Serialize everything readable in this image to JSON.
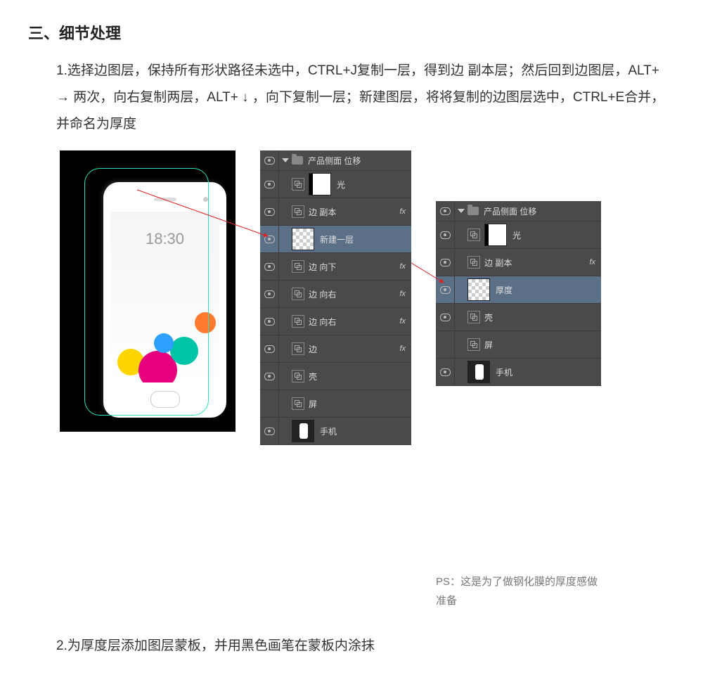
{
  "section_title": "三、细节处理",
  "step1_text": "1.选择边图层，保持所有形状路径未选中，CTRL+J复制一层，得到边 副本层；然后回到边图层，ALT+ → 两次，向右复制两层，ALT+ ↓ ，向下复制一层；新建图层，将将复制的边图层选中，CTRL+E合并，并命名为厚度",
  "phone_time": "18:30",
  "panel1": {
    "group_name": "产品侧面 位移",
    "layers": [
      {
        "label": "光",
        "thumb": "mask",
        "fx": false,
        "vis": true
      },
      {
        "label": "边 副本",
        "thumb": "link",
        "fx": true,
        "vis": true
      },
      {
        "label": "新建一层",
        "thumb": "checker",
        "fx": false,
        "vis": true,
        "active": true
      },
      {
        "label": "边 向下",
        "thumb": "link",
        "fx": true,
        "vis": true
      },
      {
        "label": "边 向右",
        "thumb": "link",
        "fx": true,
        "vis": true
      },
      {
        "label": "边 向右",
        "thumb": "link",
        "fx": true,
        "vis": true
      },
      {
        "label": "边",
        "thumb": "link",
        "fx": true,
        "vis": true
      },
      {
        "label": "壳",
        "thumb": "link",
        "fx": false,
        "vis": true
      },
      {
        "label": "屏",
        "thumb": "link",
        "fx": false,
        "vis": false
      },
      {
        "label": "手机",
        "thumb": "phone",
        "fx": false,
        "vis": true
      }
    ]
  },
  "panel2": {
    "group_name": "产品侧面 位移",
    "layers": [
      {
        "label": "光",
        "thumb": "mask",
        "fx": false,
        "vis": true
      },
      {
        "label": "边 副本",
        "thumb": "link",
        "fx": true,
        "vis": true
      },
      {
        "label": "厚度",
        "thumb": "checker",
        "fx": false,
        "vis": true,
        "active": true
      },
      {
        "label": "壳",
        "thumb": "link",
        "fx": false,
        "vis": true
      },
      {
        "label": "屏",
        "thumb": "link",
        "fx": false,
        "vis": false
      },
      {
        "label": "手机",
        "thumb": "phone",
        "fx": false,
        "vis": true
      }
    ]
  },
  "note_text": "PS：这是为了做钢化膜的厚度感做准备",
  "step2_text": "2.为厚度层添加图层蒙板，并用黑色画笔在蒙板内涂抹"
}
